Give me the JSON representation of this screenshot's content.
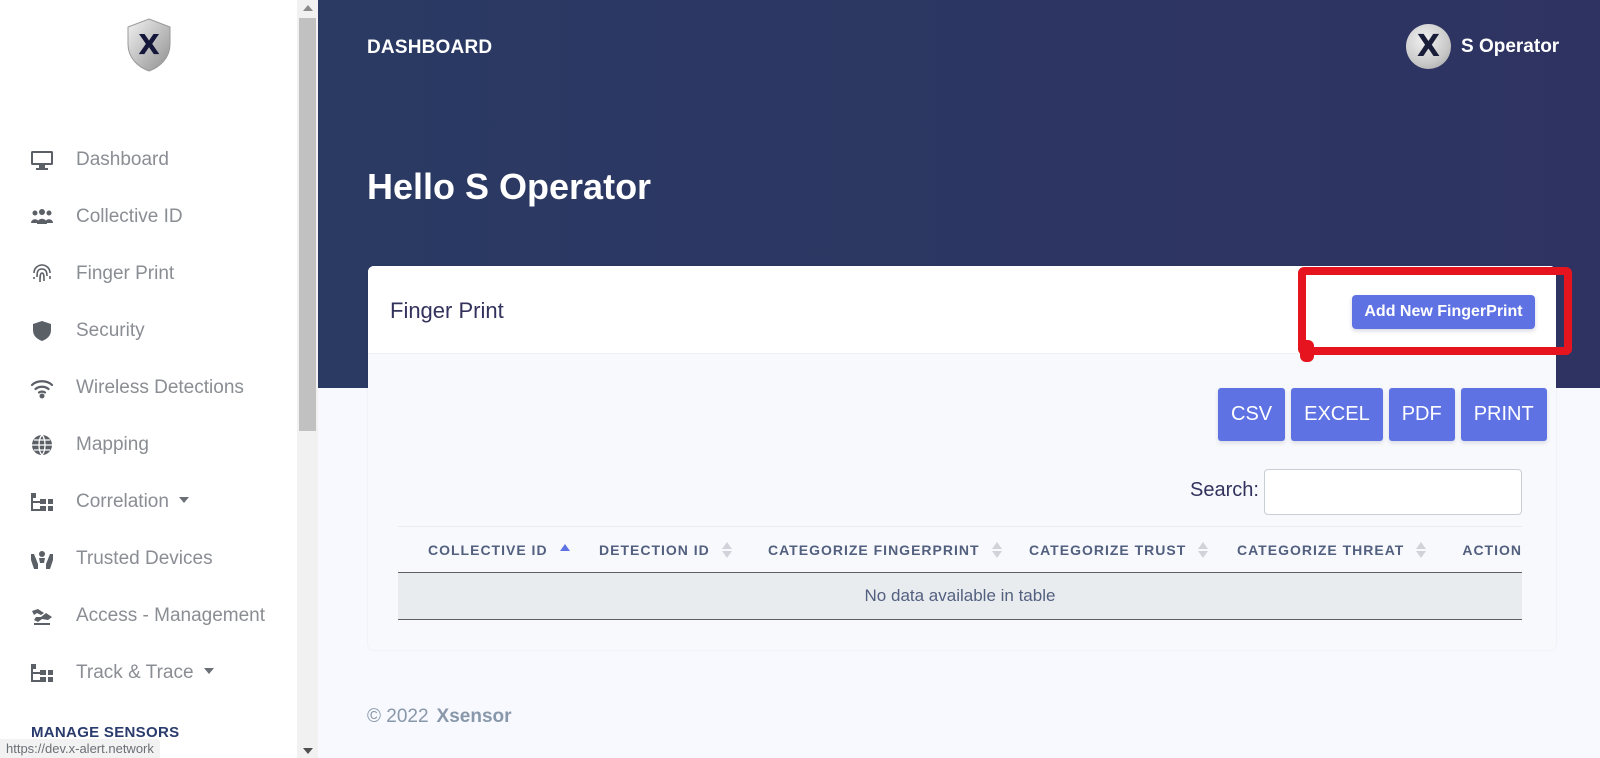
{
  "sidebar": {
    "items": [
      {
        "label": "Dashboard",
        "icon": "monitor-icon"
      },
      {
        "label": "Collective ID",
        "icon": "users-icon"
      },
      {
        "label": "Finger Print",
        "icon": "fingerprint-icon"
      },
      {
        "label": "Security",
        "icon": "shield-icon"
      },
      {
        "label": "Wireless Detections",
        "icon": "wifi-icon"
      },
      {
        "label": "Mapping",
        "icon": "globe-icon"
      },
      {
        "label": "Correlation",
        "icon": "sitemap-icon"
      },
      {
        "label": "Trusted Devices",
        "icon": "hands-icon"
      },
      {
        "label": "Access - Management",
        "icon": "handshake-icon"
      },
      {
        "label": "Track & Trace",
        "icon": "sitemap-icon"
      }
    ],
    "section_heading": "MANAGE SENSORS",
    "status_url": "https://dev.x-alert.network"
  },
  "header": {
    "title": "DASHBOARD",
    "user_name": "S Operator",
    "avatar_letter": "X",
    "greeting": "Hello S Operator"
  },
  "card": {
    "title": "Finger Print",
    "add_button": "Add New FingerPrint",
    "exports": [
      "CSV",
      "EXCEL",
      "PDF",
      "PRINT"
    ],
    "search_label": "Search:",
    "search_value": "",
    "columns": [
      "COLLECTIVE ID",
      "DETECTION ID",
      "CATEGORIZE FINGERPRINT",
      "CATEGORIZE TRUST",
      "CATEGORIZE THREAT",
      "ACTION"
    ],
    "empty_message": "No data available in table"
  },
  "footer": {
    "copyright": "© 2022",
    "brand": "Xsensor"
  },
  "colors": {
    "accent": "#5e72e4",
    "header_bg": "#2a3a63",
    "highlight": "#e6141e"
  }
}
